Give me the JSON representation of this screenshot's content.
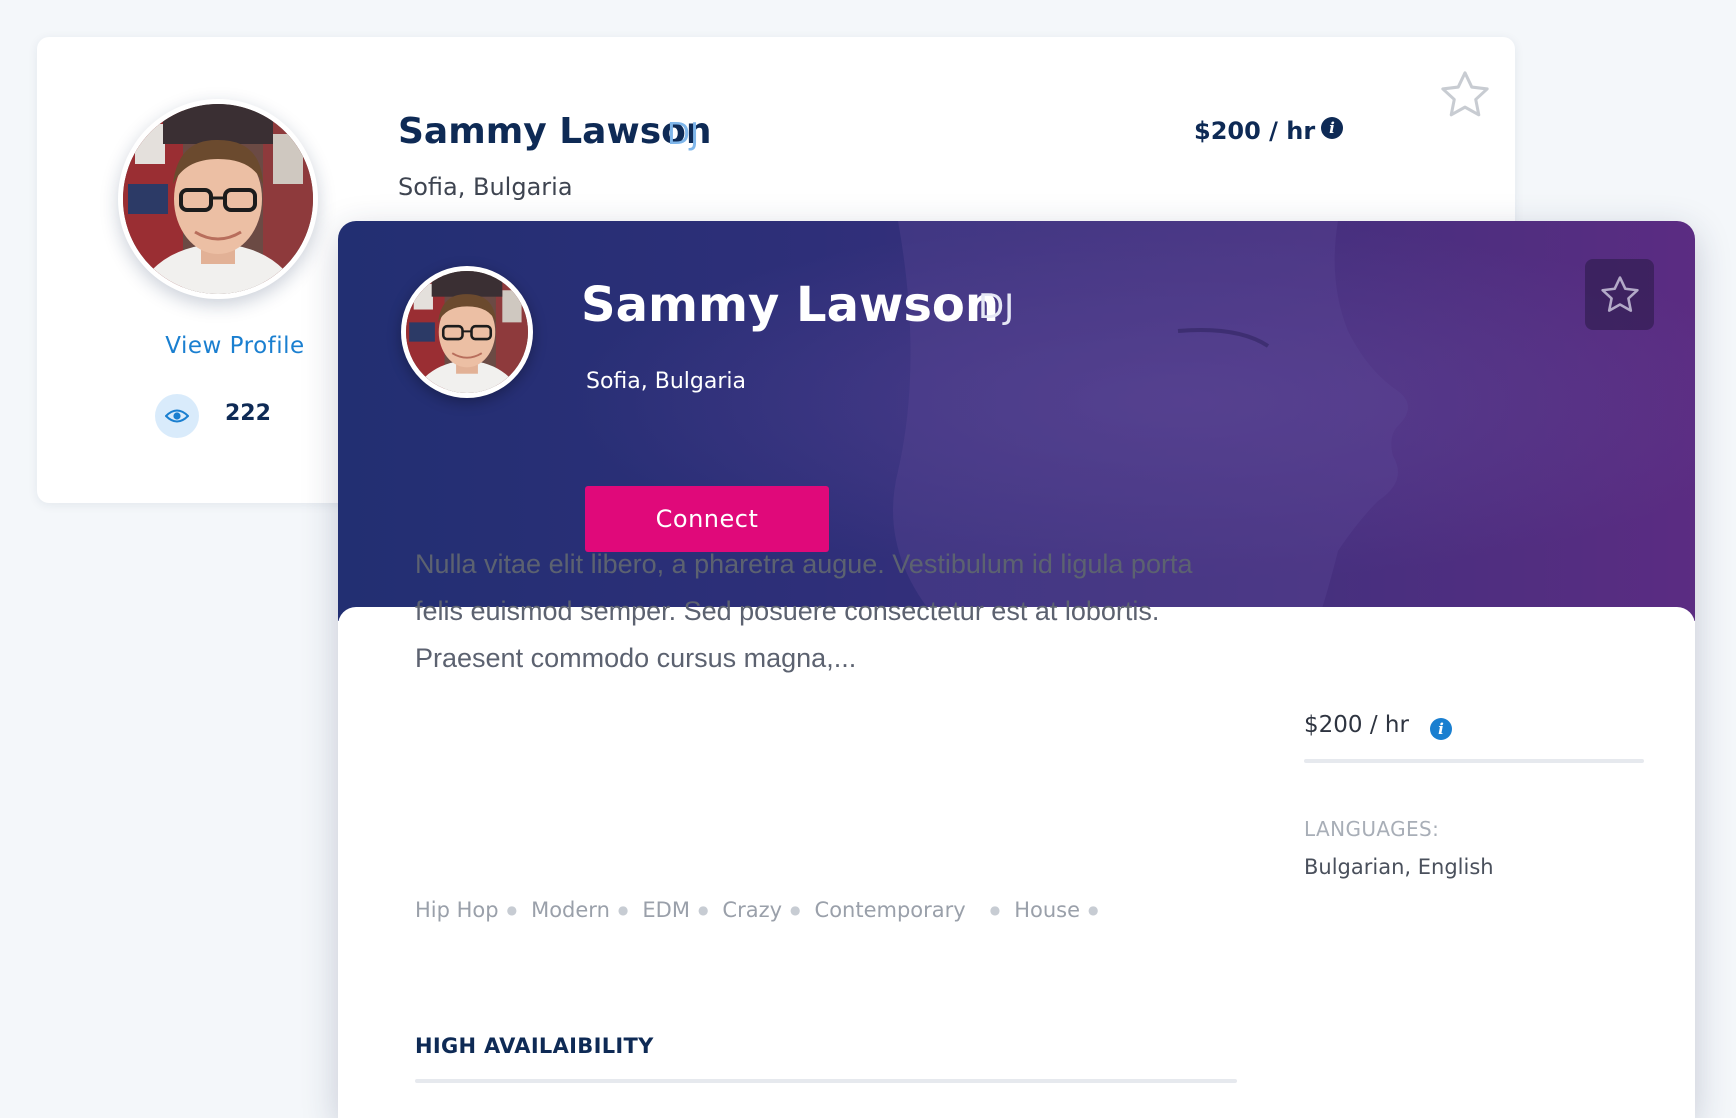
{
  "back_card": {
    "name": "Sammy Lawson",
    "role": "DJ",
    "location": "Sofia, Bulgaria",
    "rate": "$200 / hr",
    "view_profile_label": "View Profile",
    "views_count": "222"
  },
  "hero": {
    "name": "Sammy Lawson",
    "role": "DJ",
    "location": "Sofia, Bulgaria",
    "connect_label": "Connect"
  },
  "details": {
    "description": "Nulla vitae elit libero, a pharetra augue. Vestibulum id ligula porta felis euismod semper. Sed posuere consectetur est at lobortis. Praesent commodo cursus magna,...",
    "tags": [
      "Hip Hop",
      "Modern",
      "EDM",
      "Crazy",
      "Contemporary",
      "House"
    ],
    "availability_label": "HIGH AVAILAIBILITY",
    "rate": "$200 / hr",
    "languages_label": "LANGUAGES:",
    "languages_value": "Bulgarian, English"
  },
  "icons": {
    "favorite": "star-outline-icon",
    "views": "eye-icon",
    "info": "info-icon"
  },
  "colors": {
    "brand_navy": "#0e2a55",
    "accent_blue": "#1a7fd0",
    "role_blue": "#7fb6ea",
    "connect_pink": "#e0097a",
    "hero_start": "#222f72",
    "hero_end": "#5b2c82"
  }
}
